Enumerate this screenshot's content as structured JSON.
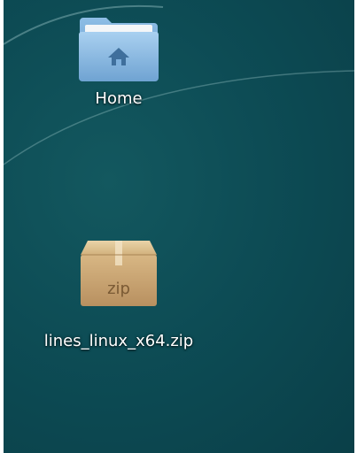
{
  "desktop": {
    "icons": [
      {
        "label": "Home",
        "icon": "home-folder-icon"
      },
      {
        "label": "lines_linux_x64.zip",
        "icon": "zip-archive-icon",
        "badge": "zip"
      }
    ]
  },
  "colors": {
    "wallpaper": "#0d4c55",
    "folder_blue": "#7fb0dc",
    "box_tan": "#c9a46f"
  }
}
